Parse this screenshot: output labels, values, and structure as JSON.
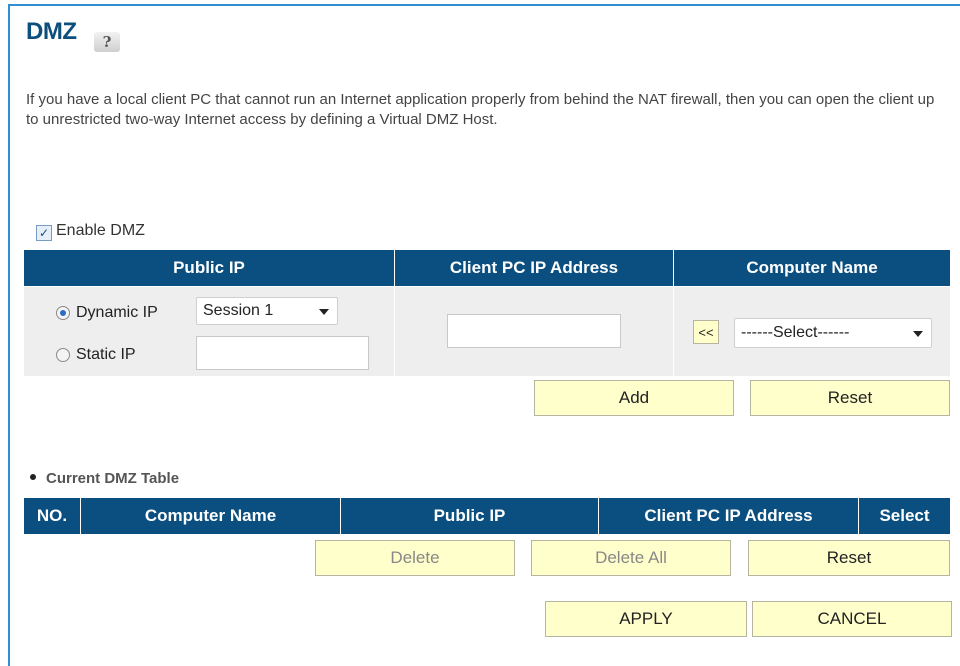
{
  "page": {
    "title": "DMZ",
    "help_icon": "help-icon",
    "description": "If you have a local client PC that cannot run an Internet application properly from behind the NAT firewall, then you can open the client up to unrestricted two-way Internet access by defining a Virtual DMZ Host."
  },
  "enable": {
    "label": "Enable DMZ",
    "checked": true
  },
  "config_table": {
    "headers": [
      "Public IP",
      "Client PC IP Address",
      "Computer Name"
    ],
    "dynamic_label": "Dynamic IP",
    "static_label": "Static IP",
    "session_value": "Session 1",
    "static_ip_value": "",
    "client_ip_value": "",
    "copy_label": "<<",
    "computer_select_value": "------Select------"
  },
  "config_buttons": {
    "add": "Add",
    "reset": "Reset"
  },
  "current_table": {
    "title": "Current DMZ Table",
    "headers": [
      "NO.",
      "Computer Name",
      "Public IP",
      "Client PC IP Address",
      "Select"
    ]
  },
  "table_buttons": {
    "delete": "Delete",
    "delete_all": "Delete All",
    "reset": "Reset"
  },
  "footer_buttons": {
    "apply": "APPLY",
    "cancel": "CANCEL"
  },
  "colors": {
    "header_bg": "#0b4f80",
    "button_bg": "#ffffcc",
    "title": "#0d4f7c"
  }
}
